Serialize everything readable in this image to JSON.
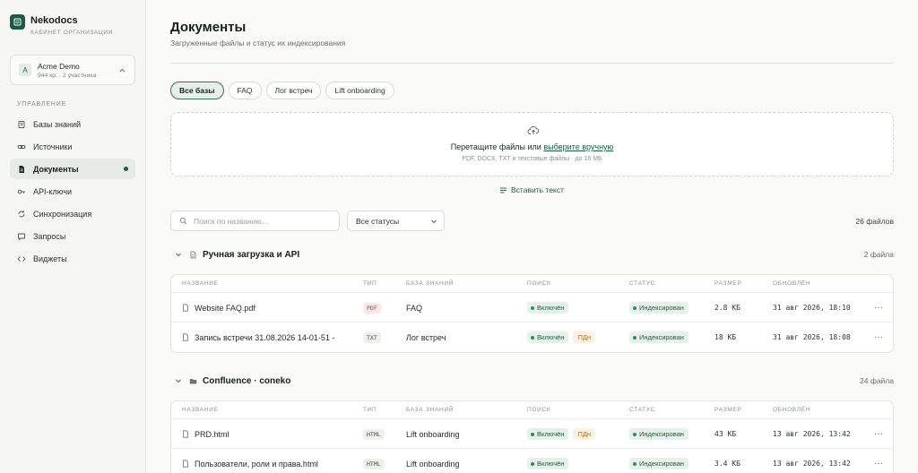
{
  "brand": {
    "name": "Nekodocs",
    "subtitle": "КАБИНЕТ ОРГАНИЗАЦИИ",
    "logo_icon": "document-stack-icon"
  },
  "org": {
    "avatar": "A",
    "name": "Acme Demo",
    "meta": "944 кр. · 2 участника"
  },
  "sidebar": {
    "section_title": "УПРАВЛЕНИЕ",
    "items": [
      {
        "label": "Базы знаний",
        "icon": "book-icon"
      },
      {
        "label": "Источники",
        "icon": "link-icon"
      },
      {
        "label": "Документы",
        "icon": "file-icon",
        "active": true
      },
      {
        "label": "API-ключи",
        "icon": "key-icon"
      },
      {
        "label": "Синхронизация",
        "icon": "sync-icon"
      },
      {
        "label": "Запросы",
        "icon": "chat-icon"
      },
      {
        "label": "Виджеты",
        "icon": "code-icon"
      }
    ]
  },
  "header": {
    "title": "Документы",
    "subtitle": "Загруженные файлы и статус их индексирования"
  },
  "filters": {
    "chips": [
      "Все базы",
      "FAQ",
      "Лог встреч",
      "Lift onboarding"
    ]
  },
  "dropzone": {
    "text_before": "Перетащите файлы или ",
    "link": "выберите вручную",
    "hint": "PDF, DOCX, TXT и текстовые файлы · до 16 МБ"
  },
  "paste_label": "Вставить текст",
  "search": {
    "placeholder": "Поиск по названию…",
    "value": ""
  },
  "status_select": {
    "selected": "Все статусы"
  },
  "file_count": "26 файлов",
  "columns": {
    "name": "НАЗВАНИЕ",
    "type": "ТИП",
    "kb": "БАЗА ЗНАНИЙ",
    "search": "ПОИСК",
    "status": "СТАТУС",
    "size": "РАЗМЕР",
    "updated": "ОБНОВЛЁН"
  },
  "groups": [
    {
      "title": "Ручная загрузка и API",
      "count": "2 файла",
      "icon": "file-icon",
      "rows": [
        {
          "name": "Website FAQ.pdf",
          "type": "PDF",
          "kb": "FAQ",
          "search": "Включён",
          "pd": "",
          "status": "Индексирован",
          "size": "2.8 КБ",
          "updated": "31 авг 2026, 18:10",
          "menu": "···"
        },
        {
          "name": "Запись встречи 31.08.2026 14-01-51 -",
          "type": "TXT",
          "kb": "Лог встреч",
          "search": "Включён",
          "pd": "ПДн",
          "status": "Индексирован",
          "size": "18 КБ",
          "updated": "31 авг 2026, 18:08",
          "menu": "···"
        }
      ]
    },
    {
      "title": "Confluence · coneko",
      "count": "24 файла",
      "icon": "folder-icon",
      "rows": [
        {
          "name": "PRD.html",
          "type": "HTML",
          "kb": "Lift onboarding",
          "search": "Включён",
          "pd": "ПДн",
          "status": "Индексирован",
          "size": "43 КБ",
          "updated": "13 авг 2026, 13:42",
          "menu": "···"
        },
        {
          "name": "Пользователи, роли и права.html",
          "type": "HTML",
          "kb": "Lift onboarding",
          "search": "Включён",
          "pd": "",
          "status": "Индексирован",
          "size": "3.4 КБ",
          "updated": "13 авг 2026, 13:42",
          "menu": "···"
        }
      ]
    }
  ],
  "colors": {
    "accent": "#1e5a45",
    "pdf": "#c0392b",
    "ok": "#2f8a5c",
    "pd": "#b0701a"
  }
}
